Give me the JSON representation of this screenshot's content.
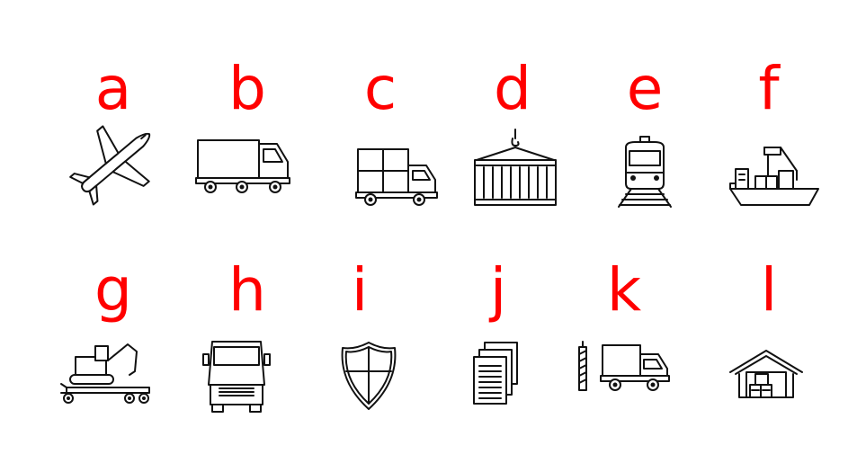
{
  "colors": {
    "letter": "#ff0000",
    "icon": "#111111",
    "background": "#ffffff"
  },
  "rows": [
    [
      {
        "label": "a",
        "icon": "airplane-icon"
      },
      {
        "label": "b",
        "icon": "semi-truck-icon"
      },
      {
        "label": "c",
        "icon": "delivery-truck-boxes-icon"
      },
      {
        "label": "d",
        "icon": "shipping-container-crane-hook-icon"
      },
      {
        "label": "e",
        "icon": "train-icon"
      },
      {
        "label": "f",
        "icon": "cargo-ship-icon"
      }
    ],
    [
      {
        "label": "g",
        "icon": "lowboy-trailer-excavator-icon"
      },
      {
        "label": "h",
        "icon": "truck-front-icon"
      },
      {
        "label": "i",
        "icon": "shield-icon"
      },
      {
        "label": "j",
        "icon": "documents-icon"
      },
      {
        "label": "k",
        "icon": "customs-border-truck-icon"
      },
      {
        "label": "l",
        "icon": "warehouse-icon"
      }
    ]
  ]
}
